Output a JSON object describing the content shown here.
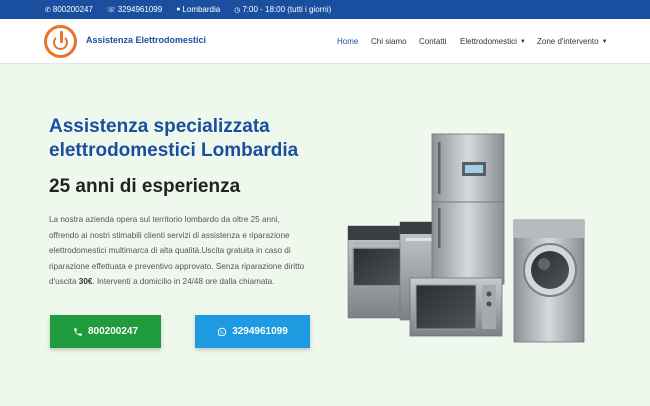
{
  "topbar": {
    "phone": "800200247",
    "whatsapp": "3294961099",
    "location": "Lombardia",
    "hours": "7:00 - 18:00 (tutti i giorni)"
  },
  "header": {
    "brand": "Assistenza Elettrodomestici",
    "nav": [
      "Home",
      "Chi siamo",
      "Contatti",
      "Elettrodomestici",
      "Zone d'intervento"
    ]
  },
  "hero": {
    "title_line1": "Assistenza specializzata",
    "title_line2": "elettrodomestici Lombardia",
    "subtitle": "25 anni di esperienza",
    "desc_before": "La nostra azienda opera sul territorio lombardo da oltre 25 anni, offrendo ai nostri stimabili clienti servizi di assistenza e riparazione elettrodomestici multimarca di alta qualità.Uscita gratuita in caso di riparazione effettuata e preventivo approvato. Senza riparazione diritto d'uscita ",
    "desc_bold": "30€",
    "desc_after": ". Interventi a domicilio in 24/48 ore dalla chiamata."
  },
  "buttons": {
    "call": "800200247",
    "whatsapp": "3294961099"
  },
  "colors": {
    "topbar": "#1a4fa0",
    "accent": "#e8732a",
    "call_button": "#1f9b3d",
    "whatsapp_button": "#1e9be0",
    "hero_background": "#eef8ec"
  }
}
